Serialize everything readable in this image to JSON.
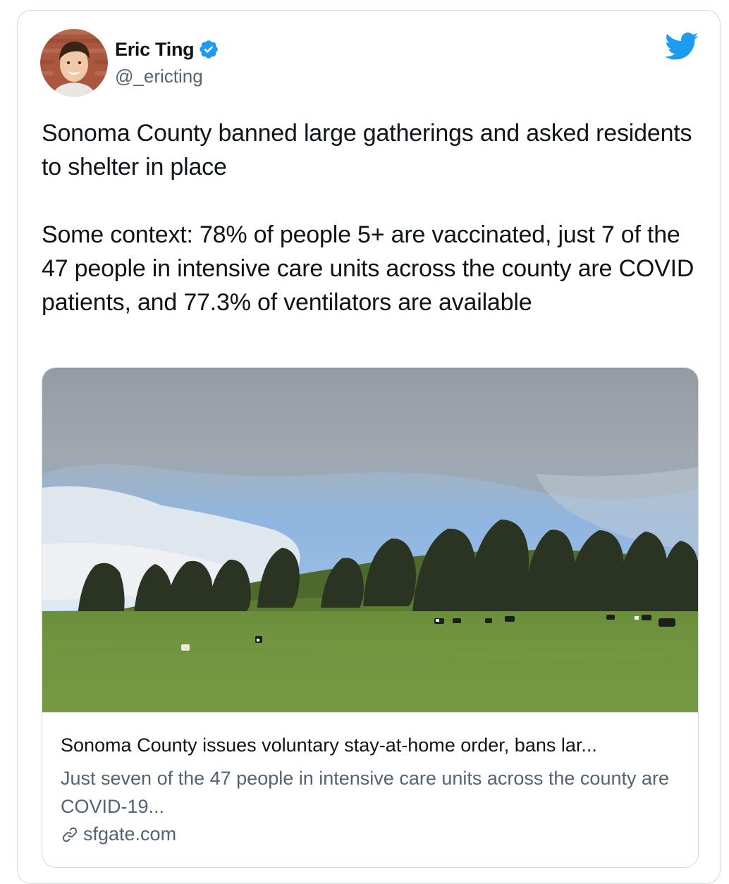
{
  "author": {
    "name": "Eric Ting",
    "handle": "@_ericting",
    "verified": true,
    "avatar_icon": "profile-photo"
  },
  "tweet": {
    "paragraphs": [
      "Sonoma County banned large gatherings and asked residents to shelter in place",
      "Some context: 78% of people 5+ are vaccinated, just 7 of the 47 people in intensive care units across the county are COVID patients, and 77.3% of ventilators are available"
    ]
  },
  "card": {
    "title": "Sonoma County issues voluntary stay-at-home order, bans lar...",
    "description": "Just seven of the 47 people in intensive care units across the county are COVID-19...",
    "domain": "sfgate.com",
    "image_icon": "landscape-photo"
  },
  "colors": {
    "twitter_blue": "#1d9bf0",
    "text_primary": "#0f1419",
    "text_secondary": "#536471",
    "border": "#cfd9de"
  },
  "icons": {
    "brand": "twitter-bird-icon",
    "verified": "verified-badge-icon",
    "link": "link-icon"
  }
}
